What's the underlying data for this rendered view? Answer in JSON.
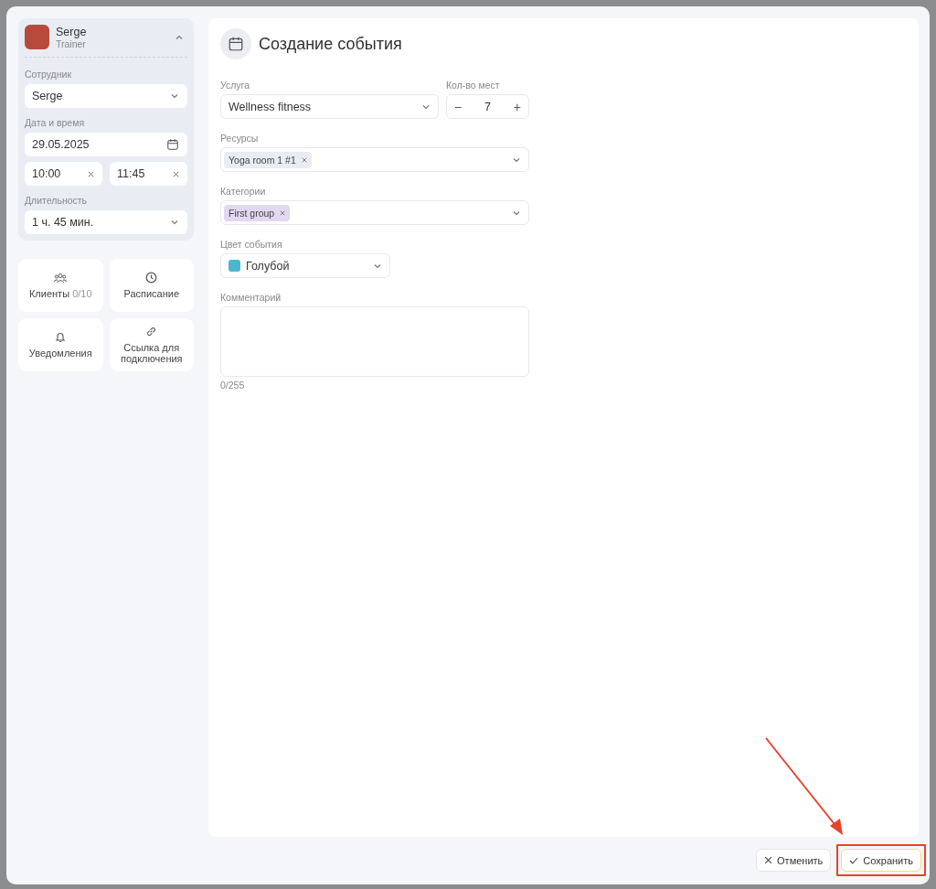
{
  "employee_card": {
    "name": "Serge",
    "role": "Trainer",
    "expanded": true,
    "fields": [
      {
        "label": "Сотрудник",
        "value": "Serge",
        "kind": "select"
      },
      {
        "label": "Дата и время",
        "value": "29.05.2025",
        "kind": "date"
      }
    ],
    "times": [
      "10:00",
      "11:45"
    ],
    "duration": {
      "label": "Длительность",
      "value": "1 ч. 45 мин."
    }
  },
  "tiles": [
    {
      "label": "Клиенты",
      "count": "0/10",
      "kind": "clients"
    },
    {
      "label": "Расписание",
      "kind": "schedule"
    },
    {
      "label": "Уведомления",
      "kind": "notifications"
    },
    {
      "label": "Ссылка для подключения",
      "kind": "link"
    }
  ],
  "form": {
    "title": "Создание события",
    "service": {
      "label": "Услуга",
      "value": "Wellness fitness"
    },
    "seats": {
      "label": "Кол-во мест",
      "minus": "−",
      "value": "7",
      "plus": "+"
    },
    "resources": {
      "label": "Ресурсы",
      "chips": [
        {
          "text": "Yoga room 1 #1",
          "color": "#e9ecf2"
        }
      ]
    },
    "categories": {
      "label": "Категории",
      "chips": [
        {
          "text": "First group",
          "color": "#e1d8f1"
        }
      ]
    },
    "event_color": {
      "label": "Цвет события",
      "value": "Голубой",
      "color": "#4db6cf"
    },
    "comment": {
      "label": "Комментарий",
      "counter": "0/255"
    }
  },
  "buttons": [
    {
      "label": "Отменить",
      "kind": "cancel",
      "highlighted": false
    },
    {
      "label": "Сохранить",
      "kind": "save",
      "highlighted": true
    }
  ]
}
